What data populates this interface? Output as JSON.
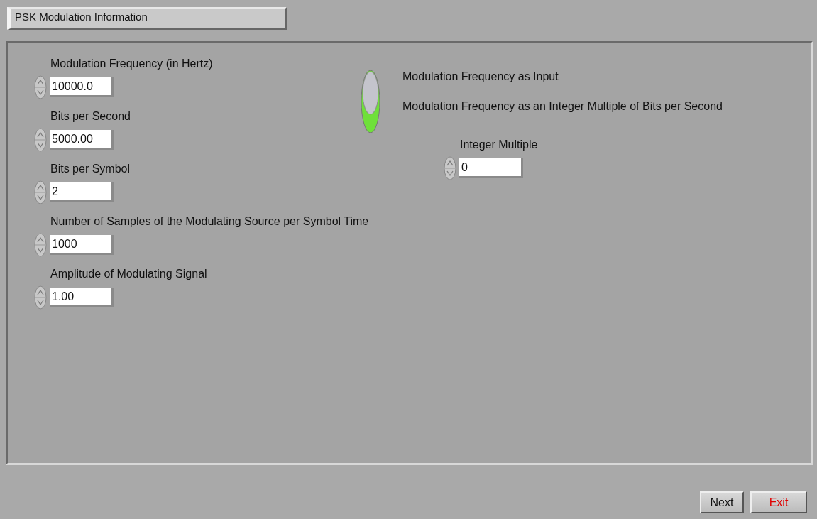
{
  "title": "PSK Modulation Information",
  "controls": [
    {
      "label": "Modulation Frequency (in Hertz)",
      "value": "10000.0"
    },
    {
      "label": "Bits per Second",
      "value": "5000.00"
    },
    {
      "label": "Bits per Symbol",
      "value": "2"
    },
    {
      "label": "Number of Samples of the Modulating Source per Symbol Time",
      "value": "1000"
    },
    {
      "label": "Amplitude of Modulating Signal",
      "value": "1.00"
    }
  ],
  "mode_switch": {
    "on": true,
    "options": [
      "Modulation Frequency as Input",
      "Modulation Frequency as an Integer Multiple of Bits per Second"
    ]
  },
  "integer_multiple": {
    "label": "Integer Multiple",
    "value": "0"
  },
  "buttons": [
    {
      "label": "Next",
      "kind": "normal"
    },
    {
      "label": "Exit",
      "kind": "danger"
    }
  ]
}
